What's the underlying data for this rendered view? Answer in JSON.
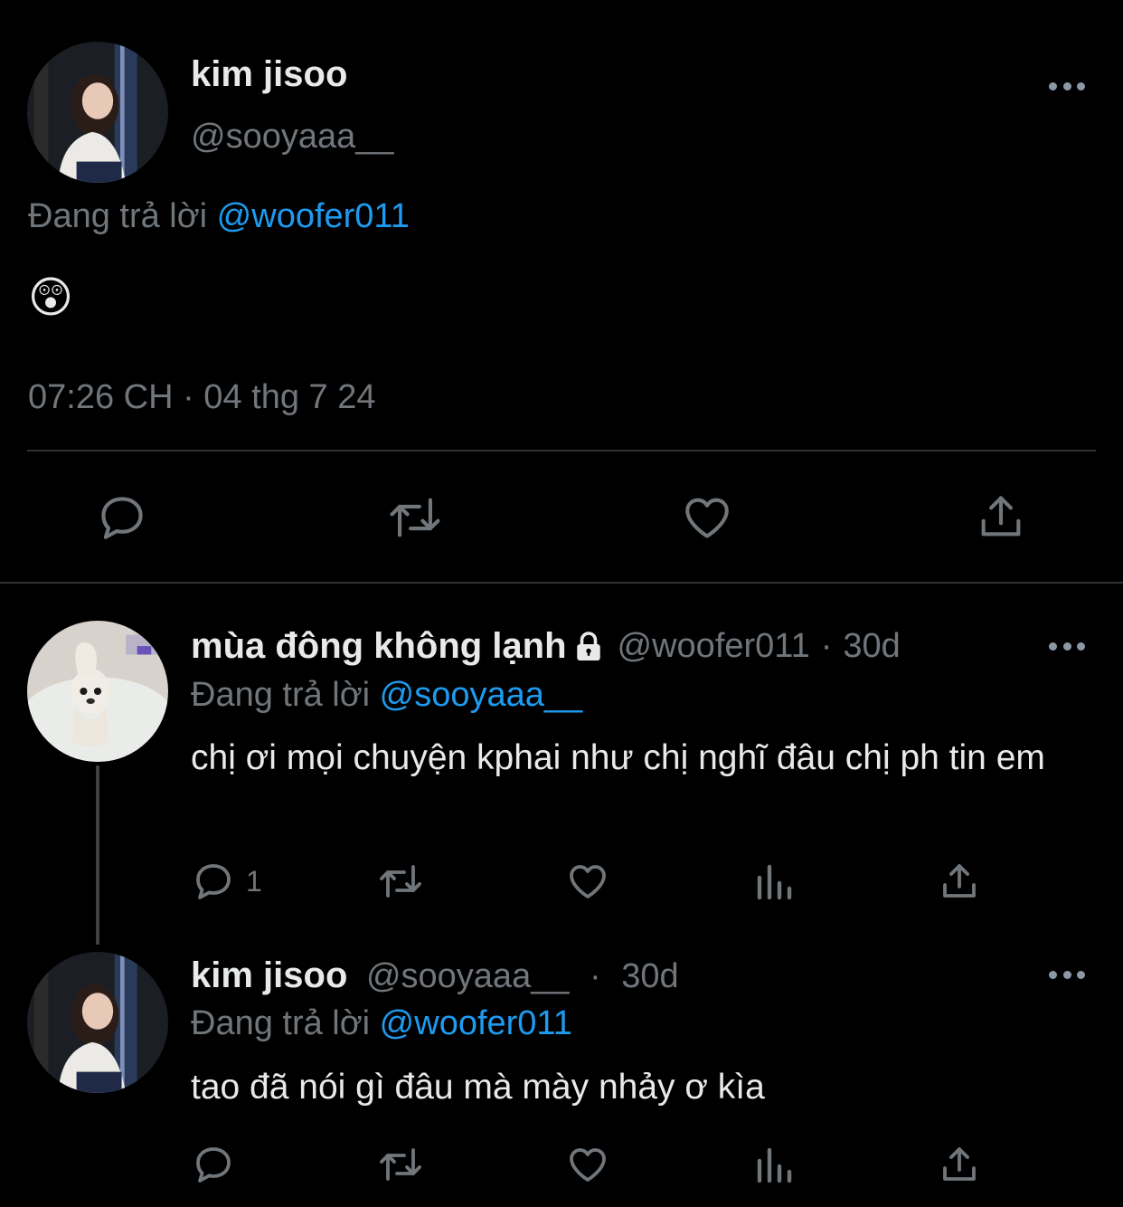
{
  "main_tweet": {
    "display_name": "kim jisoo",
    "handle": "@sooyaaa__",
    "reply_prefix": "Đang trả lời",
    "reply_to": "@woofer011",
    "body": "😲",
    "timestamp": "07:26 CH · 04 thg 7 24",
    "actions": [
      "reply-icon",
      "retweet-icon",
      "like-icon",
      "share-icon"
    ]
  },
  "reply_1": {
    "display_name": "mùa đông không lạnh",
    "handle": "@woofer011",
    "sep": "·",
    "age": "30d",
    "reply_prefix": "Đang trả lời",
    "reply_to": "@sooyaaa__",
    "body": "chị ơi mọi chuyện kphai như chị nghĩ đâu chị ph tin em",
    "reply_count": "1",
    "protected_icon": "lock-icon"
  },
  "reply_2": {
    "display_name": "kim jisoo",
    "handle": "@sooyaaa__",
    "sep": "·",
    "age": "30d",
    "reply_prefix": "Đang trả lời",
    "reply_to": "@woofer011",
    "body": "tao đã nói gì đâu mà mày nhảy ơ kìa"
  },
  "colors": {
    "background": "#000000",
    "text": "#e7e9ea",
    "secondary": "#71767b",
    "link": "#1d9bf0"
  }
}
